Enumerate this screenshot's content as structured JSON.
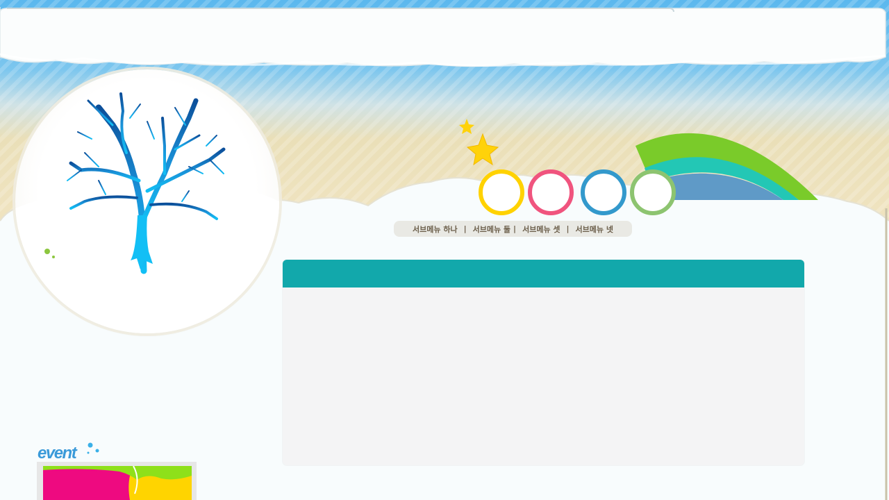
{
  "page": {
    "title": ""
  },
  "colors": {
    "sky": "#5bb8ee",
    "sand": "#efe3bf",
    "content_header": "#12a8ab",
    "content_body": "#f4f4f5",
    "ring_yellow": "#ffd200",
    "ring_pink": "#f0547e",
    "ring_blue": "#3399cc",
    "ring_green": "#8dc470",
    "tree": "#1aa0e0",
    "rainbow_green": "#7acb2a",
    "rainbow_teal": "#23c7b5",
    "rainbow_blue": "#5f9ac7"
  },
  "submenu": {
    "items": [
      {
        "label": "서브메뉴 하나"
      },
      {
        "label": "서브메뉴 둘"
      },
      {
        "label": "서브메뉴 셋"
      },
      {
        "label": "서브메뉴 넷"
      }
    ],
    "separator": "|"
  },
  "event": {
    "title": "event"
  },
  "icons": {
    "tree": "tree-illustration",
    "stars": "star-icon",
    "rainbow": "rainbow-illustration",
    "nav_rings": [
      "yellow-ring",
      "pink-ring",
      "blue-ring",
      "green-ring"
    ]
  }
}
